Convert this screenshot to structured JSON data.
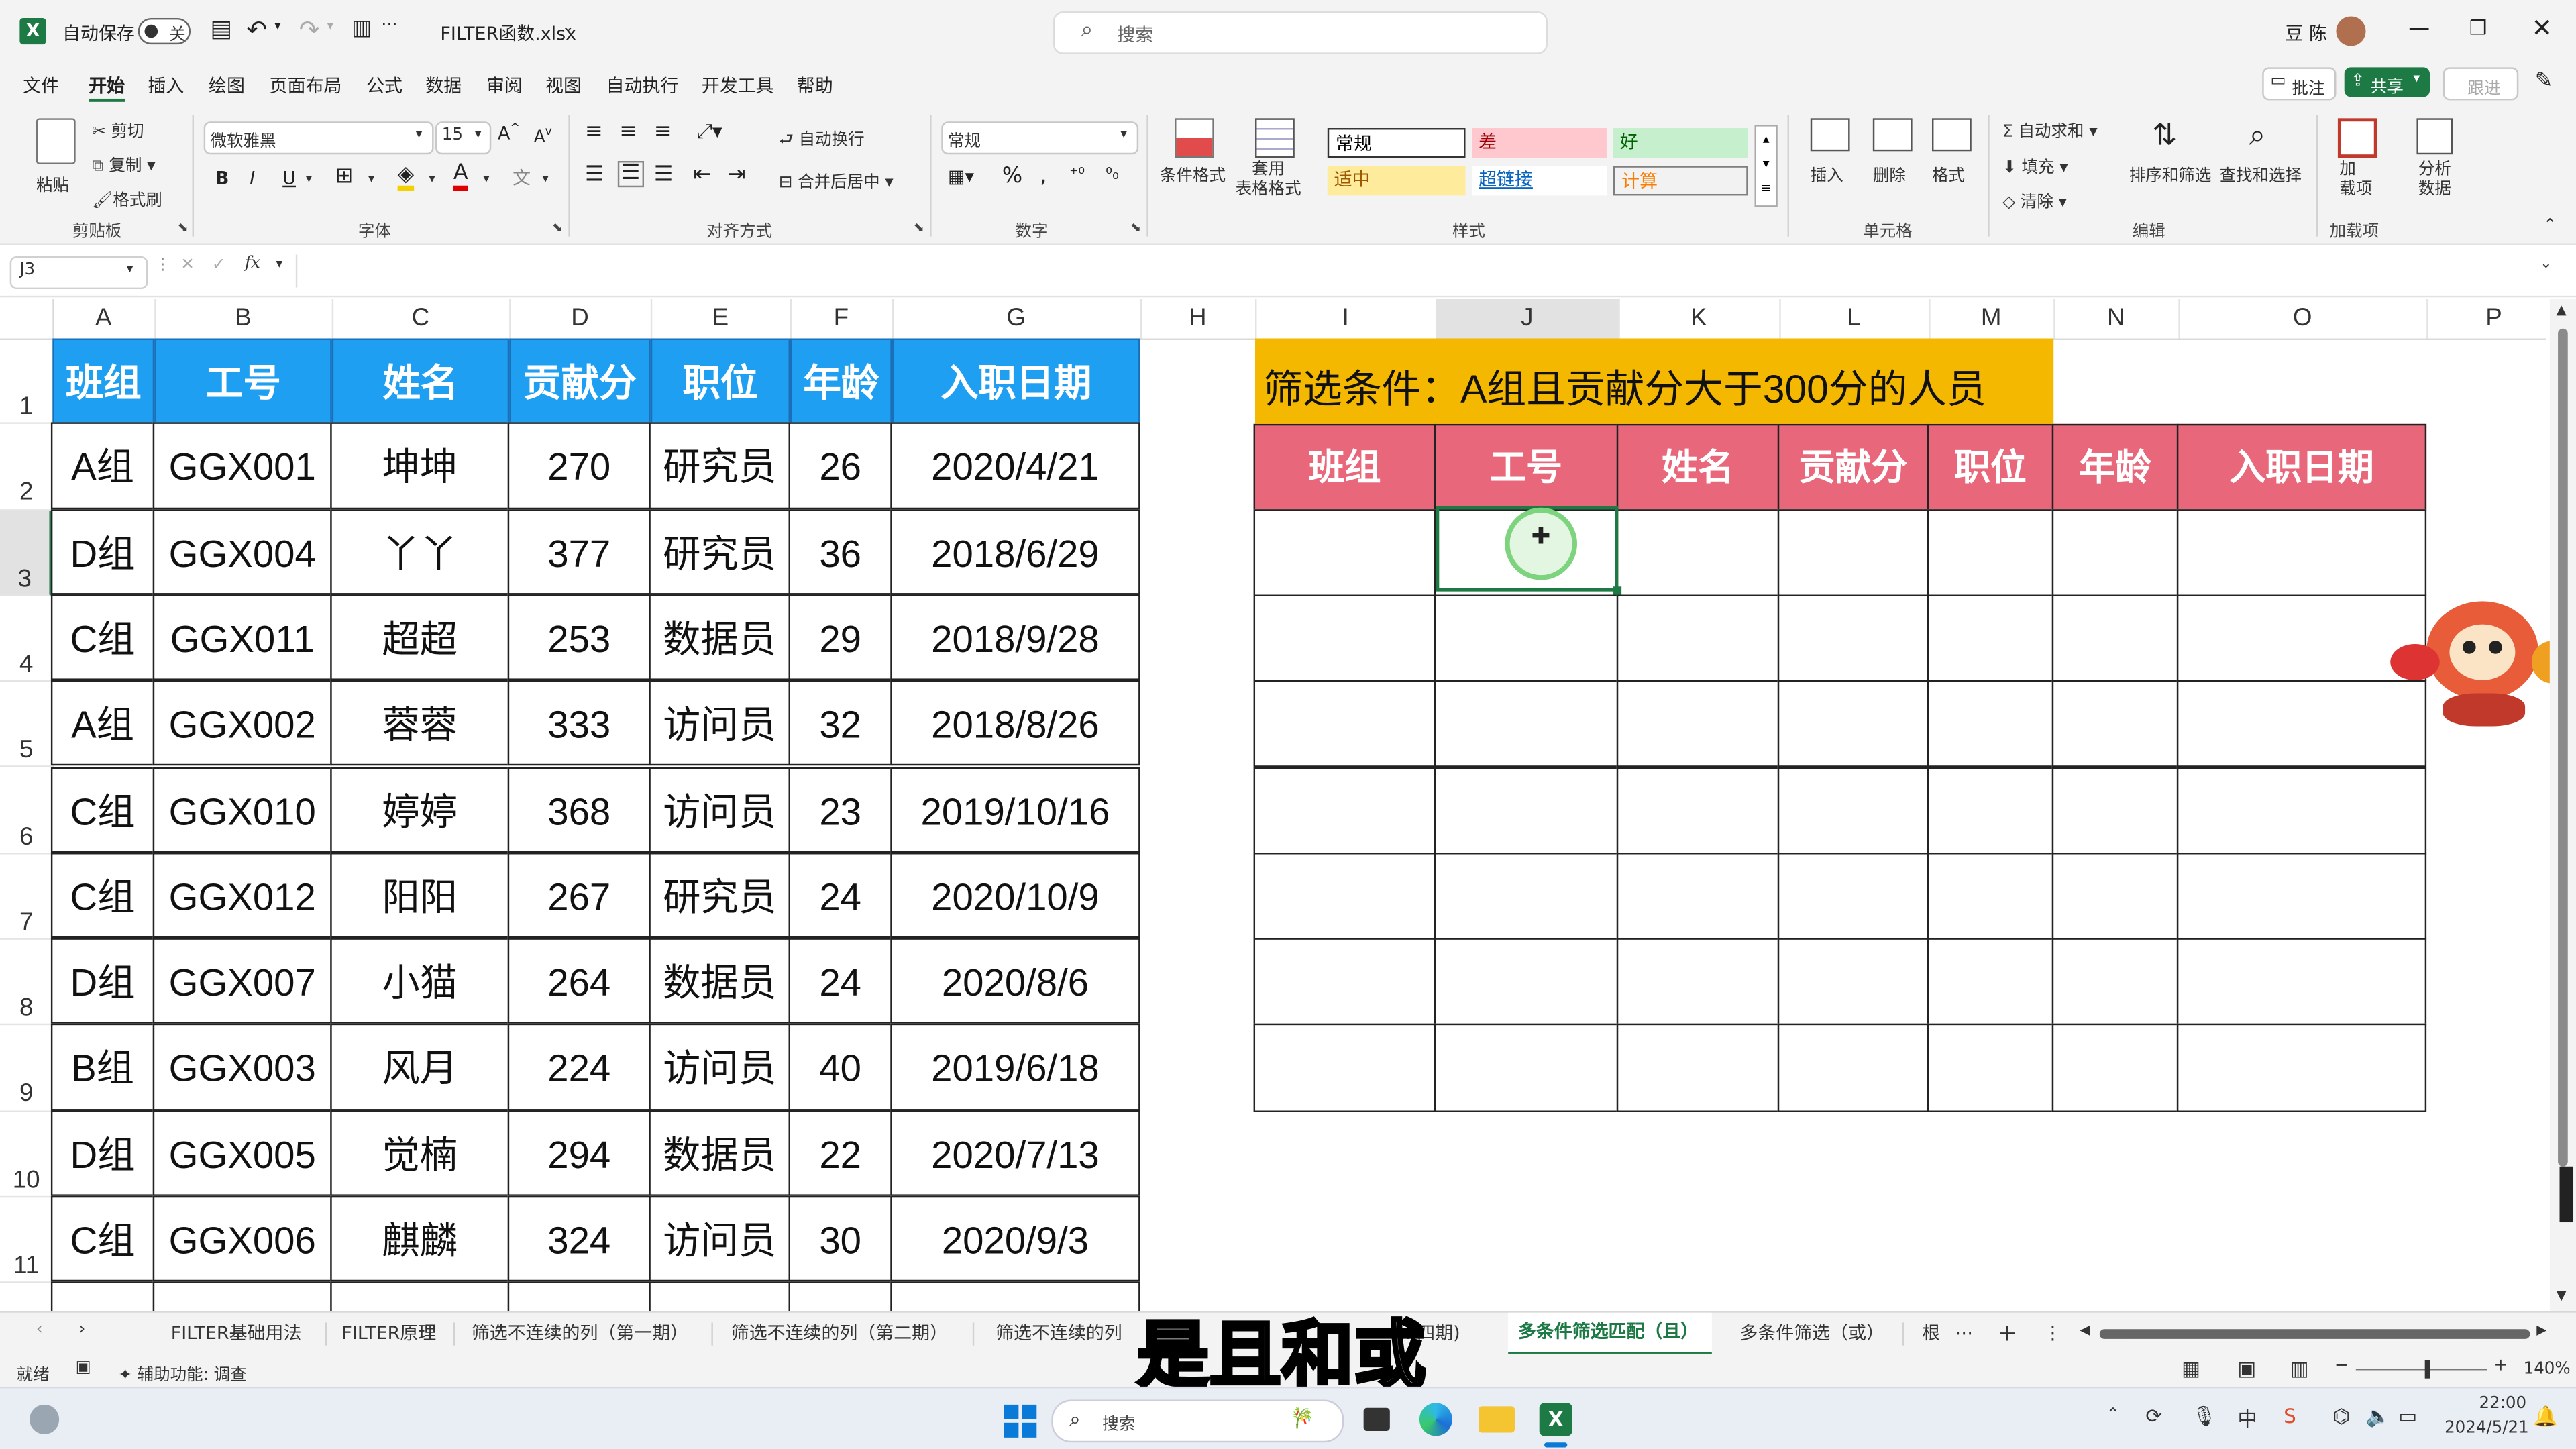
{
  "titlebar": {
    "autosave_label": "自动保存",
    "toggle_label": "关",
    "filename": "FILTER函数.xlsx",
    "search_placeholder": "搜索",
    "username": "豆 陈"
  },
  "menu": [
    "文件",
    "开始",
    "插入",
    "绘图",
    "页面布局",
    "公式",
    "数据",
    "审阅",
    "视图",
    "自动执行",
    "开发工具",
    "帮助"
  ],
  "menu_right": {
    "comments": "批注",
    "share": "共享",
    "catchup": "跟进"
  },
  "ribbon": {
    "clipboard": {
      "paste": "粘贴",
      "cut": "剪切",
      "copy": "复制",
      "format_painter": "格式刷",
      "group": "剪贴板"
    },
    "font": {
      "name": "微软雅黑",
      "size": "15",
      "group": "字体"
    },
    "alignment": {
      "wrap": "自动换行",
      "merge": "合并后居中",
      "group": "对齐方式"
    },
    "number": {
      "format": "常规",
      "group": "数字"
    },
    "styles": {
      "conditional": "条件格式",
      "table": "套用\n表格格式",
      "cells": [
        "常规",
        "差",
        "好",
        "适中",
        "超链接",
        "计算"
      ],
      "group": "样式"
    },
    "cells": {
      "insert": "插入",
      "delete": "删除",
      "format": "格式",
      "group": "单元格"
    },
    "editing": {
      "autosum": "自动求和",
      "fill": "填充",
      "clear": "清除",
      "sort": "排序和筛选",
      "find": "查找和选择",
      "group": "编辑"
    },
    "addins": {
      "addins": "加\n载项",
      "analyze": "分析\n数据",
      "group": "加载项"
    }
  },
  "formula_bar": {
    "name_box": "J3",
    "fx": "fx",
    "value": ""
  },
  "columns": [
    "A",
    "B",
    "C",
    "D",
    "E",
    "F",
    "G",
    "H",
    "I",
    "J",
    "K",
    "L",
    "M",
    "N",
    "O",
    "P"
  ],
  "rows": [
    "1",
    "2",
    "3",
    "4",
    "5",
    "6",
    "7",
    "8",
    "9",
    "10",
    "11"
  ],
  "left_table": {
    "headers": [
      "班组",
      "工号",
      "姓名",
      "贡献分",
      "职位",
      "年龄",
      "入职日期"
    ],
    "rows": [
      [
        "A组",
        "GGX001",
        "坤坤",
        "270",
        "研究员",
        "26",
        "2020/4/21"
      ],
      [
        "D组",
        "GGX004",
        "丫丫",
        "377",
        "研究员",
        "36",
        "2018/6/29"
      ],
      [
        "C组",
        "GGX011",
        "超超",
        "253",
        "数据员",
        "29",
        "2018/9/28"
      ],
      [
        "A组",
        "GGX002",
        "蓉蓉",
        "333",
        "访问员",
        "32",
        "2018/8/26"
      ],
      [
        "C组",
        "GGX010",
        "婷婷",
        "368",
        "访问员",
        "23",
        "2019/10/16"
      ],
      [
        "C组",
        "GGX012",
        "阳阳",
        "267",
        "研究员",
        "24",
        "2020/10/9"
      ],
      [
        "D组",
        "GGX007",
        "小猫",
        "264",
        "数据员",
        "24",
        "2020/8/6"
      ],
      [
        "B组",
        "GGX003",
        "风月",
        "224",
        "访问员",
        "40",
        "2019/6/18"
      ],
      [
        "D组",
        "GGX005",
        "觉楠",
        "294",
        "数据员",
        "22",
        "2020/7/13"
      ],
      [
        "C组",
        "GGX006",
        "麒麟",
        "324",
        "访问员",
        "30",
        "2020/9/3"
      ]
    ],
    "header_color": "#1e9ff2"
  },
  "right_table": {
    "title": "筛选条件：A组且贡献分大于300分的人员",
    "title_color": "#f5b800",
    "headers": [
      "班组",
      "工号",
      "姓名",
      "贡献分",
      "职位",
      "年龄",
      "入职日期"
    ],
    "header_color": "#e8677a"
  },
  "sheet_tabs": [
    "FILTER基础用法",
    "FILTER原理",
    "筛选不连续的列（第一期）",
    "筛选不连续的列（第二期）",
    "筛选不连续的列",
    "...四期)",
    "多条件筛选匹配（且）",
    "多条件筛选（或）",
    "根"
  ],
  "active_tab": "多条件筛选匹配（且）",
  "subtitle": "是且和或",
  "status": {
    "ready": "就绪",
    "accessibility": "辅助功能: 调查",
    "zoom": "140%"
  },
  "taskbar": {
    "search": "搜索",
    "time": "22:00",
    "date": "2024/5/21"
  }
}
